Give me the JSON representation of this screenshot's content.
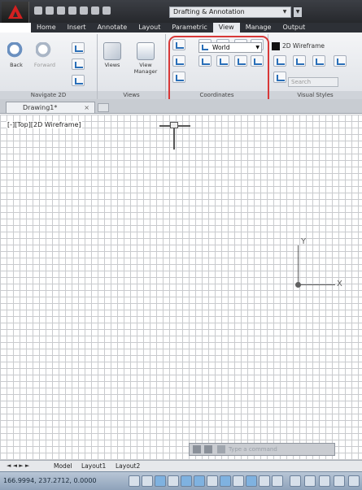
{
  "titlebar": {
    "workspace": "Drafting & Annotation"
  },
  "ribbon_tabs": [
    "Home",
    "Insert",
    "Annotate",
    "Layout",
    "Parametric",
    "View",
    "Manage",
    "Output"
  ],
  "panels": {
    "navigate": {
      "title": "Navigate 2D",
      "back_label": "Back",
      "forward_label": "Forward"
    },
    "views": {
      "title": "Views",
      "views_label": "Views",
      "view_manager_label": "View Manager"
    },
    "coordinates": {
      "title": "Coordinates",
      "ucs_value": "World"
    },
    "visual_styles": {
      "title": "Visual Styles",
      "current": "2D Wireframe",
      "search_placeholder": "Search"
    }
  },
  "doc_tab": {
    "name": "Drawing1*"
  },
  "viewport": {
    "label": "[-][Top][2D Wireframe]"
  },
  "ucs_icon": {
    "x_label": "X",
    "y_label": "Y"
  },
  "command": {
    "placeholder": "Type a command"
  },
  "layout_tabs": [
    "Model",
    "Layout1",
    "Layout2"
  ],
  "status": {
    "coordinates": "166.9994, 237.2712, 0.0000"
  }
}
